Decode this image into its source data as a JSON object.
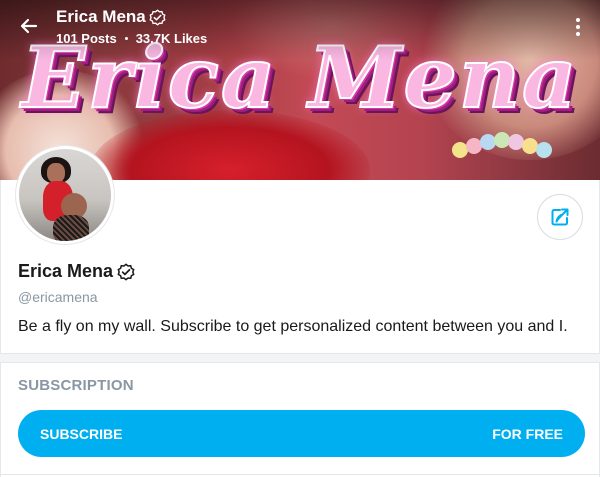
{
  "header": {
    "name": "Erica Mena",
    "posts": "101 Posts",
    "likes": "33.7K Likes"
  },
  "cover": {
    "title_text": "Erica Mena"
  },
  "profile": {
    "name": "Erica Mena",
    "handle": "@ericamena",
    "bio": "Be a fly on my wall. Subscribe to get personalized content between you and I."
  },
  "subscription": {
    "heading": "SUBSCRIPTION",
    "button_label": "SUBSCRIBE",
    "button_price": "FOR FREE"
  },
  "colors": {
    "accent": "#00aff0",
    "muted_text": "#8a96a3",
    "cover_title": "#f9b7e2"
  },
  "icons": [
    "arrow-left-icon",
    "verified-badge-icon",
    "more-vertical-icon",
    "share-icon"
  ]
}
